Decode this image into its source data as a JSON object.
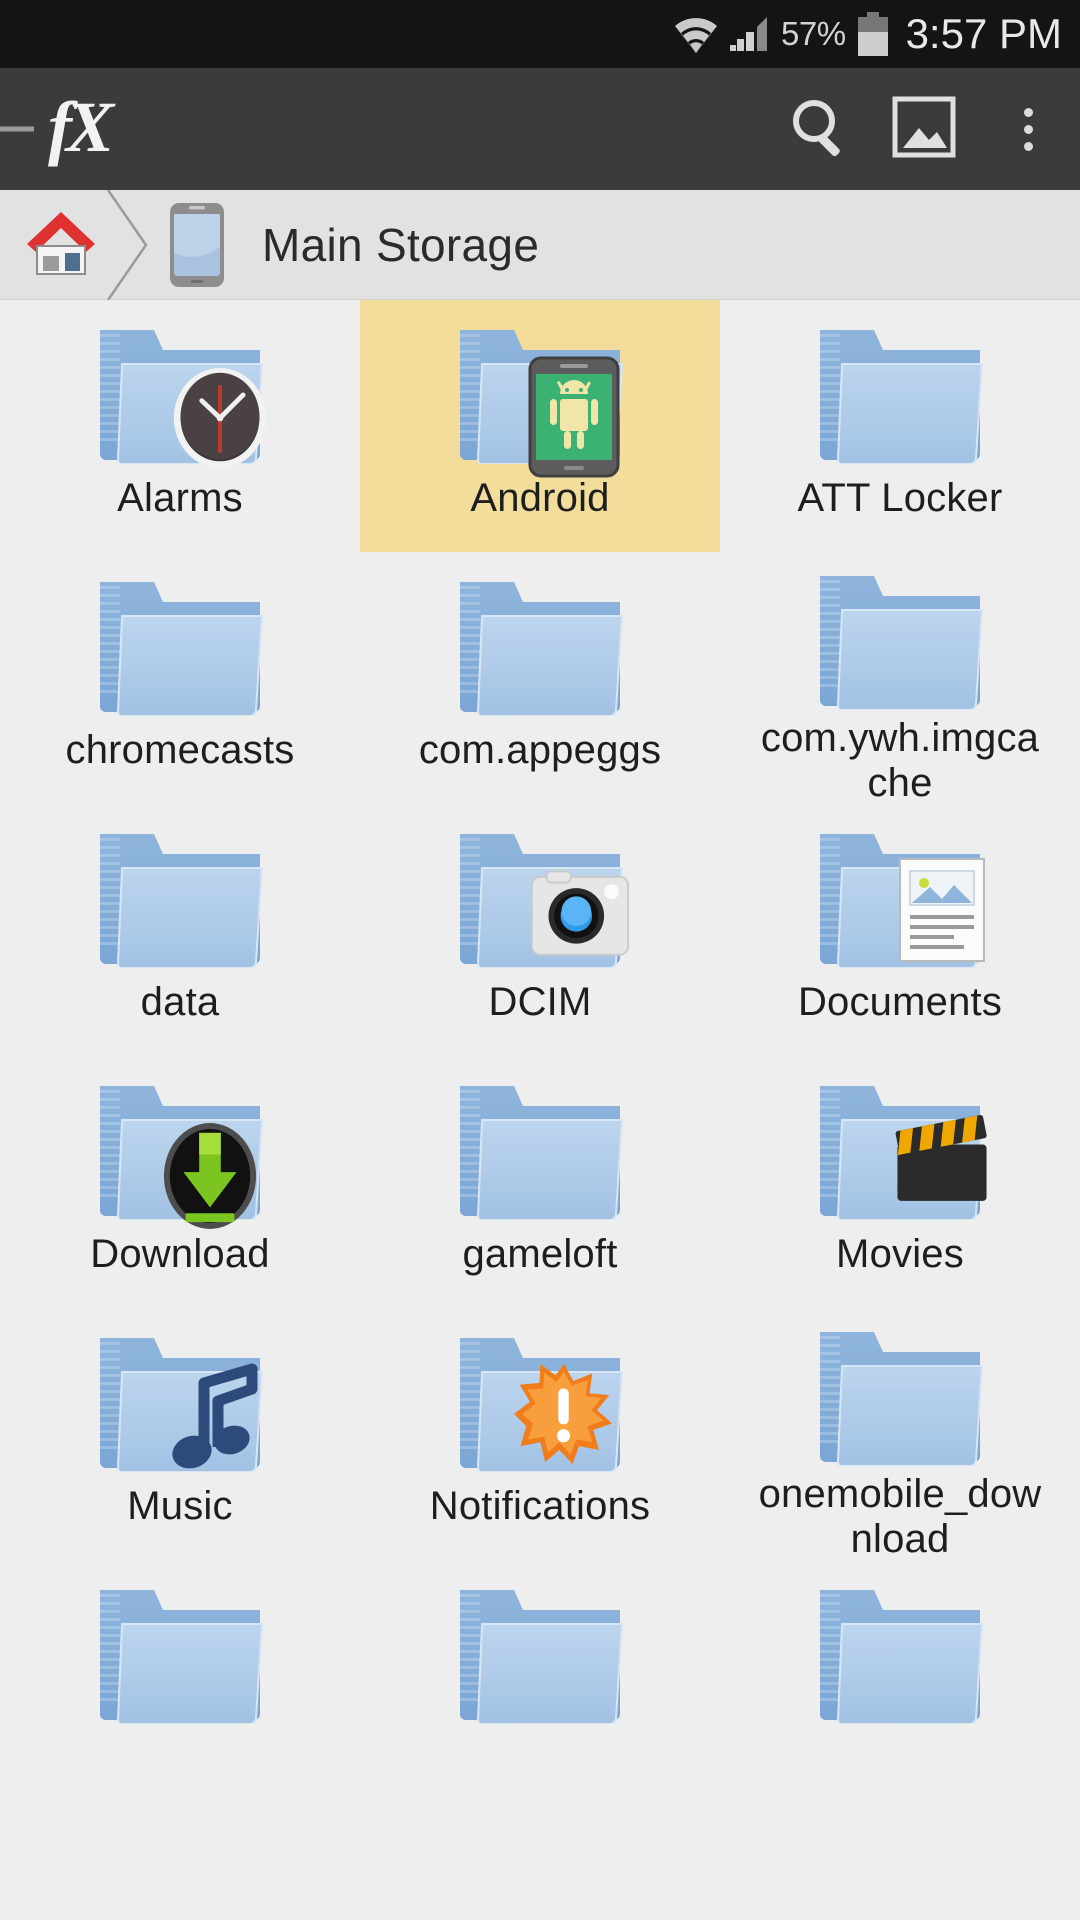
{
  "statusbar": {
    "wifi_icon": "wifi-icon",
    "signal_icon": "cellular-signal-icon",
    "battery_percent": "57%",
    "battery_icon": "battery-icon",
    "clock": "3:57 PM"
  },
  "toolbar": {
    "app_logo": "fX",
    "drawer_icon": "drawer-handle-icon",
    "search_icon": "search-icon",
    "gallery_icon": "image-gallery-icon",
    "overflow_icon": "overflow-menu-icon"
  },
  "breadcrumb": {
    "home_icon": "home-icon",
    "separator_icon": "chevron-separator-icon",
    "device_icon": "device-storage-icon",
    "current_label": "Main Storage"
  },
  "grid": {
    "selected_index": 1,
    "highlight_color": "#f2dd9b",
    "items": [
      {
        "label": "Alarms",
        "badge": "clock-badge-icon",
        "selected": false
      },
      {
        "label": "Android",
        "badge": "android-phone-badge-icon",
        "selected": true
      },
      {
        "label": "ATT Locker",
        "badge": "none",
        "selected": false
      },
      {
        "label": "chromecasts",
        "badge": "none",
        "selected": false
      },
      {
        "label": "com.appeggs",
        "badge": "none",
        "selected": false
      },
      {
        "label": "com.ywh.imgcache",
        "badge": "none",
        "selected": false
      },
      {
        "label": "data",
        "badge": "none",
        "selected": false
      },
      {
        "label": "DCIM",
        "badge": "camera-badge-icon",
        "selected": false
      },
      {
        "label": "Documents",
        "badge": "document-badge-icon",
        "selected": false
      },
      {
        "label": "Download",
        "badge": "download-arrow-badge-icon",
        "selected": false
      },
      {
        "label": "gameloft",
        "badge": "none",
        "selected": false
      },
      {
        "label": "Movies",
        "badge": "clapperboard-badge-icon",
        "selected": false
      },
      {
        "label": "Music",
        "badge": "music-note-badge-icon",
        "selected": false
      },
      {
        "label": "Notifications",
        "badge": "notification-burst-badge-icon",
        "selected": false
      },
      {
        "label": "onemobile_download",
        "badge": "none",
        "selected": false
      },
      {
        "label": "",
        "badge": "none",
        "selected": false
      },
      {
        "label": "",
        "badge": "none",
        "selected": false
      },
      {
        "label": "",
        "badge": "none",
        "selected": false
      }
    ]
  }
}
